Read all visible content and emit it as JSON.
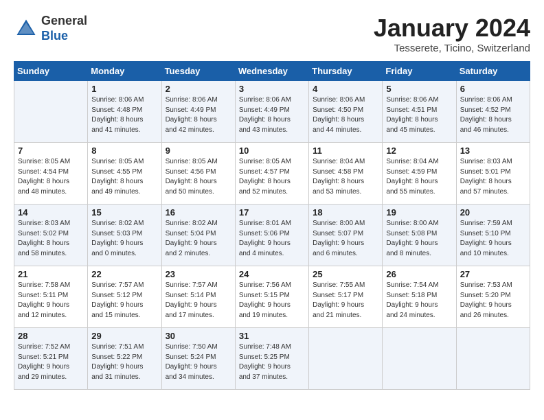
{
  "header": {
    "logo_general": "General",
    "logo_blue": "Blue",
    "month_title": "January 2024",
    "subtitle": "Tesserete, Ticino, Switzerland"
  },
  "weekdays": [
    "Sunday",
    "Monday",
    "Tuesday",
    "Wednesday",
    "Thursday",
    "Friday",
    "Saturday"
  ],
  "weeks": [
    [
      {
        "day": "",
        "info": ""
      },
      {
        "day": "1",
        "info": "Sunrise: 8:06 AM\nSunset: 4:48 PM\nDaylight: 8 hours\nand 41 minutes."
      },
      {
        "day": "2",
        "info": "Sunrise: 8:06 AM\nSunset: 4:49 PM\nDaylight: 8 hours\nand 42 minutes."
      },
      {
        "day": "3",
        "info": "Sunrise: 8:06 AM\nSunset: 4:49 PM\nDaylight: 8 hours\nand 43 minutes."
      },
      {
        "day": "4",
        "info": "Sunrise: 8:06 AM\nSunset: 4:50 PM\nDaylight: 8 hours\nand 44 minutes."
      },
      {
        "day": "5",
        "info": "Sunrise: 8:06 AM\nSunset: 4:51 PM\nDaylight: 8 hours\nand 45 minutes."
      },
      {
        "day": "6",
        "info": "Sunrise: 8:06 AM\nSunset: 4:52 PM\nDaylight: 8 hours\nand 46 minutes."
      }
    ],
    [
      {
        "day": "7",
        "info": "Sunrise: 8:05 AM\nSunset: 4:54 PM\nDaylight: 8 hours\nand 48 minutes."
      },
      {
        "day": "8",
        "info": "Sunrise: 8:05 AM\nSunset: 4:55 PM\nDaylight: 8 hours\nand 49 minutes."
      },
      {
        "day": "9",
        "info": "Sunrise: 8:05 AM\nSunset: 4:56 PM\nDaylight: 8 hours\nand 50 minutes."
      },
      {
        "day": "10",
        "info": "Sunrise: 8:05 AM\nSunset: 4:57 PM\nDaylight: 8 hours\nand 52 minutes."
      },
      {
        "day": "11",
        "info": "Sunrise: 8:04 AM\nSunset: 4:58 PM\nDaylight: 8 hours\nand 53 minutes."
      },
      {
        "day": "12",
        "info": "Sunrise: 8:04 AM\nSunset: 4:59 PM\nDaylight: 8 hours\nand 55 minutes."
      },
      {
        "day": "13",
        "info": "Sunrise: 8:03 AM\nSunset: 5:01 PM\nDaylight: 8 hours\nand 57 minutes."
      }
    ],
    [
      {
        "day": "14",
        "info": "Sunrise: 8:03 AM\nSunset: 5:02 PM\nDaylight: 8 hours\nand 58 minutes."
      },
      {
        "day": "15",
        "info": "Sunrise: 8:02 AM\nSunset: 5:03 PM\nDaylight: 9 hours\nand 0 minutes."
      },
      {
        "day": "16",
        "info": "Sunrise: 8:02 AM\nSunset: 5:04 PM\nDaylight: 9 hours\nand 2 minutes."
      },
      {
        "day": "17",
        "info": "Sunrise: 8:01 AM\nSunset: 5:06 PM\nDaylight: 9 hours\nand 4 minutes."
      },
      {
        "day": "18",
        "info": "Sunrise: 8:00 AM\nSunset: 5:07 PM\nDaylight: 9 hours\nand 6 minutes."
      },
      {
        "day": "19",
        "info": "Sunrise: 8:00 AM\nSunset: 5:08 PM\nDaylight: 9 hours\nand 8 minutes."
      },
      {
        "day": "20",
        "info": "Sunrise: 7:59 AM\nSunset: 5:10 PM\nDaylight: 9 hours\nand 10 minutes."
      }
    ],
    [
      {
        "day": "21",
        "info": "Sunrise: 7:58 AM\nSunset: 5:11 PM\nDaylight: 9 hours\nand 12 minutes."
      },
      {
        "day": "22",
        "info": "Sunrise: 7:57 AM\nSunset: 5:12 PM\nDaylight: 9 hours\nand 15 minutes."
      },
      {
        "day": "23",
        "info": "Sunrise: 7:57 AM\nSunset: 5:14 PM\nDaylight: 9 hours\nand 17 minutes."
      },
      {
        "day": "24",
        "info": "Sunrise: 7:56 AM\nSunset: 5:15 PM\nDaylight: 9 hours\nand 19 minutes."
      },
      {
        "day": "25",
        "info": "Sunrise: 7:55 AM\nSunset: 5:17 PM\nDaylight: 9 hours\nand 21 minutes."
      },
      {
        "day": "26",
        "info": "Sunrise: 7:54 AM\nSunset: 5:18 PM\nDaylight: 9 hours\nand 24 minutes."
      },
      {
        "day": "27",
        "info": "Sunrise: 7:53 AM\nSunset: 5:20 PM\nDaylight: 9 hours\nand 26 minutes."
      }
    ],
    [
      {
        "day": "28",
        "info": "Sunrise: 7:52 AM\nSunset: 5:21 PM\nDaylight: 9 hours\nand 29 minutes."
      },
      {
        "day": "29",
        "info": "Sunrise: 7:51 AM\nSunset: 5:22 PM\nDaylight: 9 hours\nand 31 minutes."
      },
      {
        "day": "30",
        "info": "Sunrise: 7:50 AM\nSunset: 5:24 PM\nDaylight: 9 hours\nand 34 minutes."
      },
      {
        "day": "31",
        "info": "Sunrise: 7:48 AM\nSunset: 5:25 PM\nDaylight: 9 hours\nand 37 minutes."
      },
      {
        "day": "",
        "info": ""
      },
      {
        "day": "",
        "info": ""
      },
      {
        "day": "",
        "info": ""
      }
    ]
  ]
}
